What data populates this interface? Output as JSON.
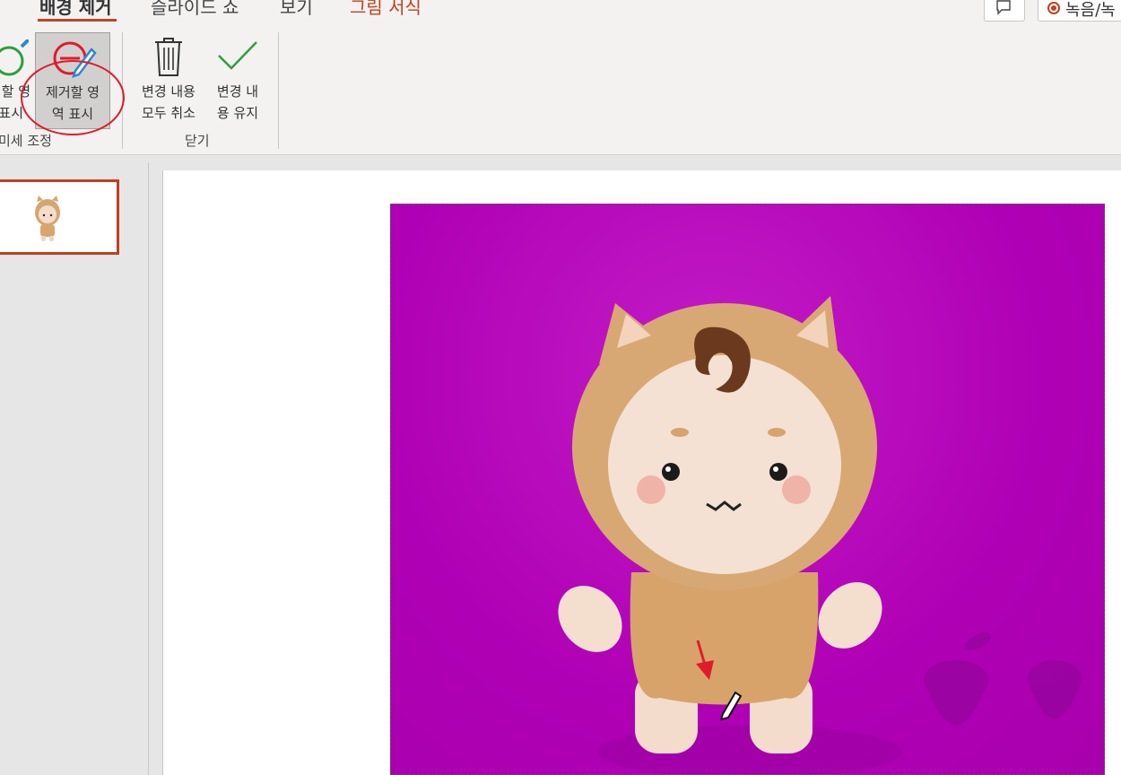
{
  "tabs": {
    "background_removal": "배경 제거",
    "slideshow": "슬라이드 쇼",
    "view": "보기",
    "picture_format": "그림 서식"
  },
  "top_right": {
    "record_label": "녹음/녹"
  },
  "ribbon": {
    "mark_keep": {
      "line1": "할 영",
      "line2": "표시"
    },
    "mark_remove": {
      "line1": "제거할 영",
      "line2": "역 표시"
    },
    "discard_changes": {
      "line1": "변경 내용",
      "line2": "모두 취소"
    },
    "keep_changes": {
      "line1": "변경 내",
      "line2": "용 유지"
    },
    "group_refine": "미세 조정",
    "group_close": "닫기"
  },
  "colors": {
    "accent": "#c43e1c",
    "magenta_background": "#b000b5",
    "annotation_red": "#e11b2b"
  }
}
